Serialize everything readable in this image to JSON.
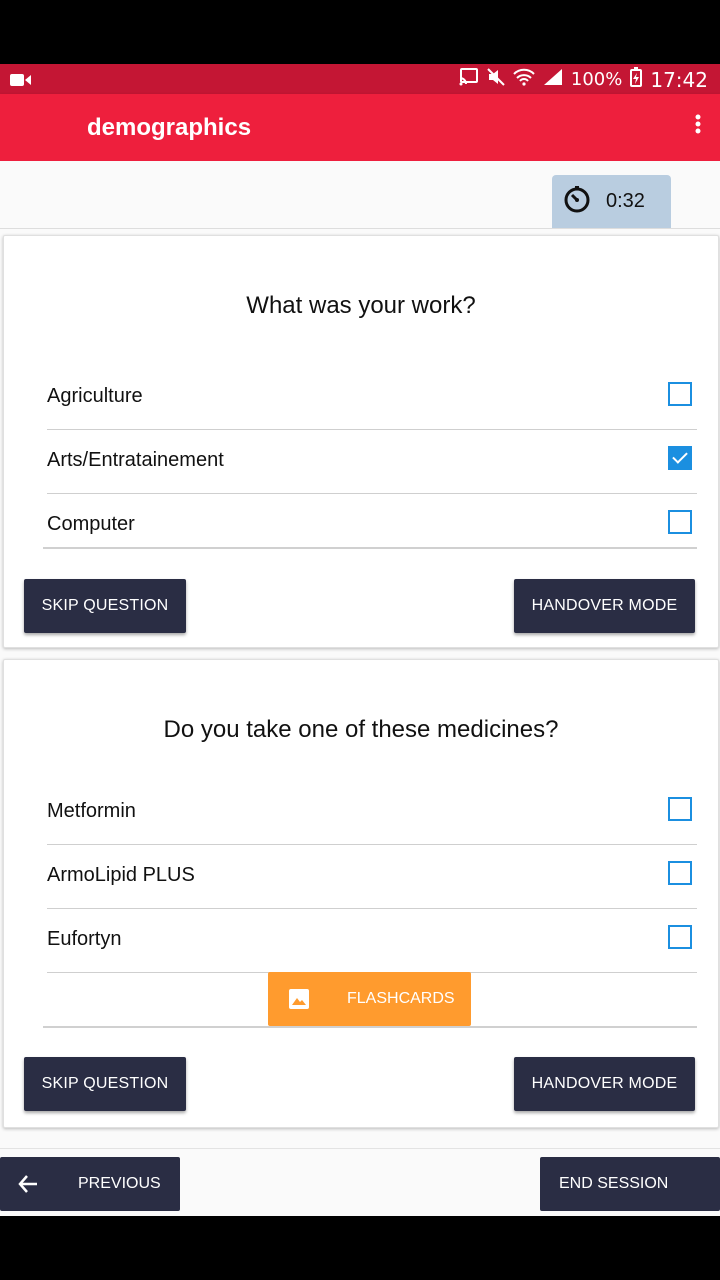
{
  "status_bar": {
    "battery": "100%",
    "time": "17:42",
    "icons": [
      "video-camera-icon",
      "cast-icon",
      "mute-icon",
      "wifi-icon",
      "signal-icon",
      "battery-charging-icon"
    ]
  },
  "app_bar": {
    "title": "demographics",
    "menu_icon": "more-vertical-icon",
    "color": "#ee1f3d"
  },
  "timer": {
    "icon": "timer-icon",
    "value": "0:32"
  },
  "questions": [
    {
      "title": "What was your work?",
      "options": [
        {
          "label": "Agriculture",
          "checked": false
        },
        {
          "label": "Arts/Entratainement",
          "checked": true
        },
        {
          "label": "Computer",
          "checked": false
        }
      ],
      "skip_label": "SKIP QUESTION",
      "handover_label": "HANDOVER MODE"
    },
    {
      "title": "Do you take one of these medicines?",
      "options": [
        {
          "label": "Metformin",
          "checked": false
        },
        {
          "label": "ArmoLipid PLUS",
          "checked": false
        },
        {
          "label": "Eufortyn",
          "checked": false
        }
      ],
      "flashcards_label": "FLASHCARDS",
      "skip_label": "SKIP QUESTION",
      "handover_label": "HANDOVER MODE"
    }
  ],
  "nav": {
    "previous_label": "PREVIOUS",
    "end_label": "END SESSION"
  },
  "colors": {
    "accent": "#1b8fe0",
    "button_dark": "#2a2d44",
    "flashcards": "#ff9b2e"
  }
}
